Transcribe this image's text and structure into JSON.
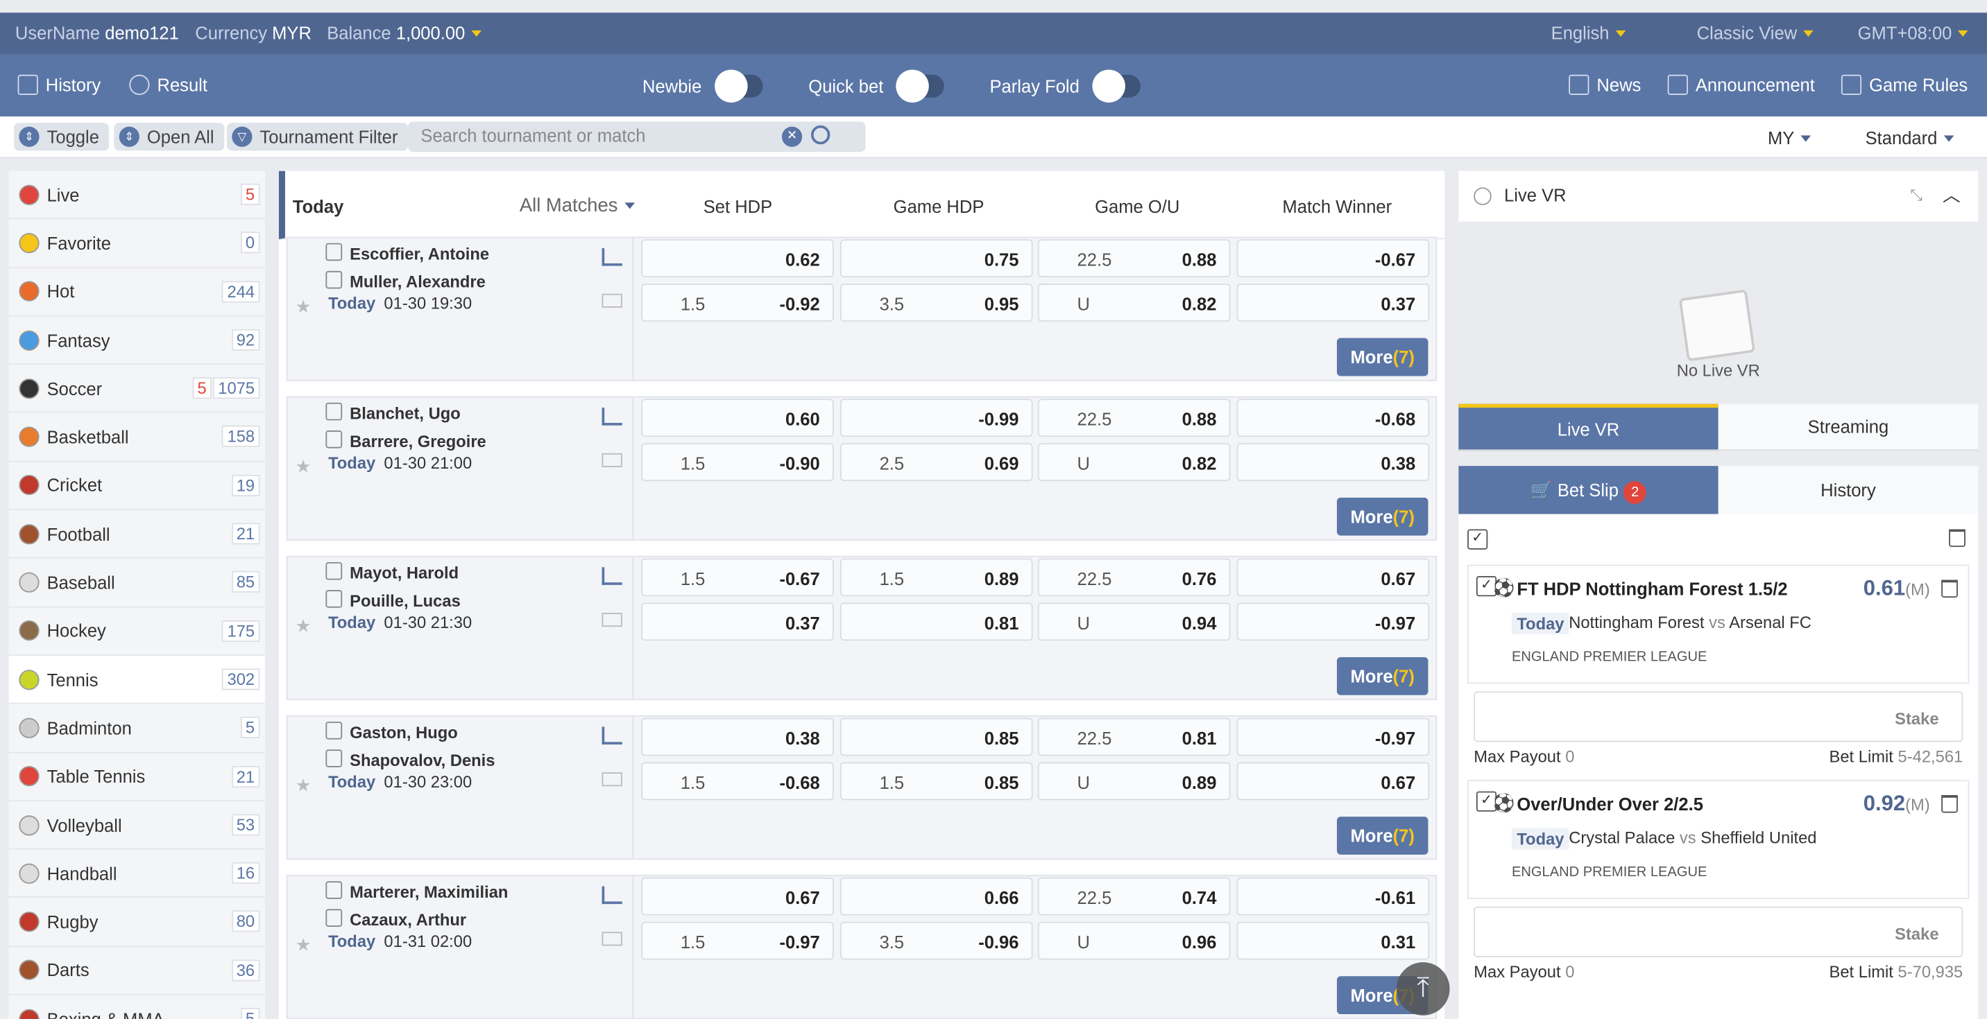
{
  "top": {
    "username_label": "UserName",
    "username": "demo121",
    "currency_label": "Currency",
    "currency": "MYR",
    "balance_label": "Balance",
    "balance": "1,000.00",
    "language": "English",
    "view": "Classic View",
    "timezone": "GMT+08:00"
  },
  "nav": {
    "history": "History",
    "result": "Result",
    "newbie": "Newbie",
    "quick_bet": "Quick bet",
    "parlay_fold": "Parlay Fold",
    "news": "News",
    "announcement": "Announcement",
    "game_rules": "Game Rules"
  },
  "filters": {
    "toggle": "Toggle",
    "open_all": "Open All",
    "tournament_filter": "Tournament Filter",
    "search_placeholder": "Search tournament or match",
    "region": "MY",
    "odds_type": "Standard"
  },
  "sports": [
    {
      "name": "Live",
      "count": "5",
      "live": "",
      "color": "#e0453c"
    },
    {
      "name": "Favorite",
      "count": "0",
      "live": "",
      "color": "#f5c518"
    },
    {
      "name": "Hot",
      "count": "244",
      "live": "",
      "color": "#e86a2c"
    },
    {
      "name": "Fantasy",
      "count": "92",
      "live": "",
      "color": "#4a9be0"
    },
    {
      "name": "Soccer",
      "count": "1075",
      "live": "5",
      "color": "#333333"
    },
    {
      "name": "Basketball",
      "count": "158",
      "live": "",
      "color": "#e87c2c"
    },
    {
      "name": "Cricket",
      "count": "19",
      "live": "",
      "color": "#c0392b"
    },
    {
      "name": "Football",
      "count": "21",
      "live": "",
      "color": "#a0522d"
    },
    {
      "name": "Baseball",
      "count": "85",
      "live": "",
      "color": "#dddddd"
    },
    {
      "name": "Hockey",
      "count": "175",
      "live": "",
      "color": "#8b6b4a"
    },
    {
      "name": "Tennis",
      "count": "302",
      "live": "",
      "color": "#c8d629"
    },
    {
      "name": "Badminton",
      "count": "5",
      "live": "",
      "color": "#cccccc"
    },
    {
      "name": "Table Tennis",
      "count": "21",
      "live": "",
      "color": "#e0453c"
    },
    {
      "name": "Volleyball",
      "count": "53",
      "live": "",
      "color": "#dddddd"
    },
    {
      "name": "Handball",
      "count": "16",
      "live": "",
      "color": "#dddddd"
    },
    {
      "name": "Rugby",
      "count": "80",
      "live": "",
      "color": "#c0392b"
    },
    {
      "name": "Darts",
      "count": "36",
      "live": "",
      "color": "#a0522d"
    },
    {
      "name": "Boxing & MMA",
      "count": "5",
      "live": "",
      "color": "#c0392b"
    }
  ],
  "header": {
    "today": "Today",
    "all_matches": "All Matches",
    "set_hdp": "Set HDP",
    "game_hdp": "Game HDP",
    "game_ou": "Game O/U",
    "match_winner": "Match Winner"
  },
  "matches": [
    {
      "p1": "Escoffier, Antoine",
      "p2": "Muller, Alexandre",
      "day": "Today",
      "time": "01-30 19:30",
      "r1": [
        "",
        "0.62",
        "",
        "0.75",
        "22.5",
        "0.88",
        "",
        "-0.67"
      ],
      "r2": [
        "1.5",
        "-0.92",
        "3.5",
        "0.95",
        "U",
        "0.82",
        "",
        "0.37"
      ],
      "more": "More",
      "more_count": "(7)"
    },
    {
      "p1": "Blanchet, Ugo",
      "p2": "Barrere, Gregoire",
      "day": "Today",
      "time": "01-30 21:00",
      "r1": [
        "",
        "0.60",
        "",
        "-0.99",
        "22.5",
        "0.88",
        "",
        "-0.68"
      ],
      "r2": [
        "1.5",
        "-0.90",
        "2.5",
        "0.69",
        "U",
        "0.82",
        "",
        "0.38"
      ],
      "more": "More",
      "more_count": "(7)"
    },
    {
      "p1": "Mayot, Harold",
      "p2": "Pouille, Lucas",
      "day": "Today",
      "time": "01-30 21:30",
      "r1": [
        "1.5",
        "-0.67",
        "1.5",
        "0.89",
        "22.5",
        "0.76",
        "",
        "0.67"
      ],
      "r2": [
        "",
        "0.37",
        "",
        "0.81",
        "U",
        "0.94",
        "",
        "-0.97"
      ],
      "more": "More",
      "more_count": "(7)"
    },
    {
      "p1": "Gaston, Hugo",
      "p2": "Shapovalov, Denis",
      "day": "Today",
      "time": "01-30 23:00",
      "r1": [
        "",
        "0.38",
        "",
        "0.85",
        "22.5",
        "0.81",
        "",
        "-0.97"
      ],
      "r2": [
        "1.5",
        "-0.68",
        "1.5",
        "0.85",
        "U",
        "0.89",
        "",
        "0.67"
      ],
      "more": "More",
      "more_count": "(7)"
    },
    {
      "p1": "Marterer, Maximilian",
      "p2": "Cazaux, Arthur",
      "day": "Today",
      "time": "01-31 02:00",
      "r1": [
        "",
        "0.67",
        "",
        "0.66",
        "22.5",
        "0.74",
        "",
        "-0.61"
      ],
      "r2": [
        "1.5",
        "-0.97",
        "3.5",
        "-0.96",
        "U",
        "0.96",
        "",
        "0.31"
      ],
      "more": "More",
      "more_count": "(7)"
    }
  ],
  "live_vr": {
    "title": "Live VR",
    "empty": "No Live VR",
    "tab_live": "Live VR",
    "tab_streaming": "Streaming"
  },
  "bet_slip": {
    "tab": "Bet Slip",
    "count": "2",
    "history": "History",
    "bets": [
      {
        "title": "FT HDP Nottingham Forest 1.5/2",
        "odds": "0.61",
        "odds_type": "(M)",
        "day": "Today",
        "home": "Nottingham Forest",
        "vs": "vs",
        "away": "Arsenal FC",
        "league": "ENGLAND PREMIER LEAGUE",
        "stake": "Stake",
        "max_payout_label": "Max Payout",
        "max_payout": "0",
        "limit_label": "Bet Limit",
        "limit": "5-42,561"
      },
      {
        "title": "Over/Under Over 2/2.5",
        "odds": "0.92",
        "odds_type": "(M)",
        "day": "Today",
        "home": "Crystal Palace",
        "vs": "vs",
        "away": "Sheffield United",
        "league": "ENGLAND PREMIER LEAGUE",
        "stake": "Stake",
        "max_payout_label": "Max Payout",
        "max_payout": "0",
        "limit_label": "Bet Limit",
        "limit": "5-70,935"
      }
    ]
  }
}
